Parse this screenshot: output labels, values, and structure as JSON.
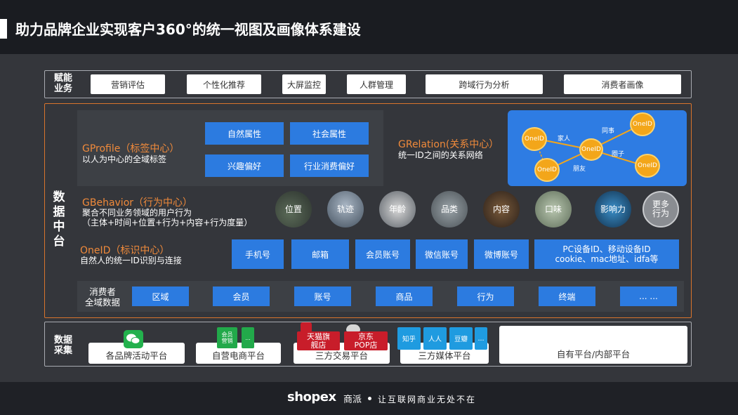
{
  "title": "助力品牌企业实现客户360°的统一视图及画像体系建设",
  "business": {
    "label_line1": "赋能",
    "label_line2": "业务",
    "items": [
      "营销评估",
      "个性化推荐",
      "大屏监控",
      "人群管理",
      "跨域行为分析",
      "消费者画像"
    ]
  },
  "middle": {
    "label_chars": [
      "数",
      "据",
      "中",
      "台"
    ],
    "gprofile": {
      "title": "GProfile（标签中心）",
      "desc": "以人为中心的全域标签",
      "tags": [
        "自然属性",
        "社会属性",
        "兴趣偏好",
        "行业消费偏好"
      ]
    },
    "grelation": {
      "title": "GRelation(关系中心）",
      "desc": "统一ID之间的关系网络",
      "nodes": [
        "OneID",
        "OneID",
        "OneID",
        "OneID",
        "OneID"
      ],
      "relations": [
        "家人",
        "同事",
        "圈子",
        "朋友"
      ]
    },
    "gbehavior": {
      "title": "GBehavior（行为中心）",
      "desc_line1": "聚合不同业务领域的用户行为",
      "desc_line2": "（主体+时间+位置+行为+内容+行为度量）",
      "items": [
        "位置",
        "轨迹",
        "年龄",
        "品类",
        "内容",
        "口味",
        "影响力",
        "更多行为"
      ]
    },
    "oneid": {
      "title": "OneID（标识中心）",
      "desc": "自然人的统一ID识别与连接",
      "ids": [
        "手机号",
        "邮箱",
        "会员账号",
        "微信账号",
        "微博账号"
      ],
      "device_line1": "PC设备ID、移动设备ID",
      "device_line2": "cookie、mac地址、idfa等"
    },
    "consumer": {
      "label_line1": "消费者",
      "label_line2": "全域数据",
      "items": [
        "区域",
        "会员",
        "账号",
        "商品",
        "行为",
        "终端",
        "... ..."
      ]
    }
  },
  "collection": {
    "label_line1": "数据",
    "label_line2": "采集",
    "platforms": [
      "各品牌活动平台",
      "自营电商平台",
      "三方交易平台",
      "三方媒体平台",
      "自有平台/内部平台"
    ],
    "ecom_icons": [
      "会员营销",
      "..."
    ],
    "trade_icons": [
      "天猫旗舰店",
      "京东POP店"
    ],
    "media_icons": [
      "知乎",
      "人人",
      "豆瓣",
      "..."
    ]
  },
  "footer": {
    "brand": "shopex",
    "brand_cn": "商派",
    "slogan": "让互联网商业无处不在"
  },
  "colors": {
    "accent_orange": "#f08a3b",
    "button_blue": "#2c7be0",
    "panel_gray": "#3d4045",
    "background": "#34363b"
  }
}
